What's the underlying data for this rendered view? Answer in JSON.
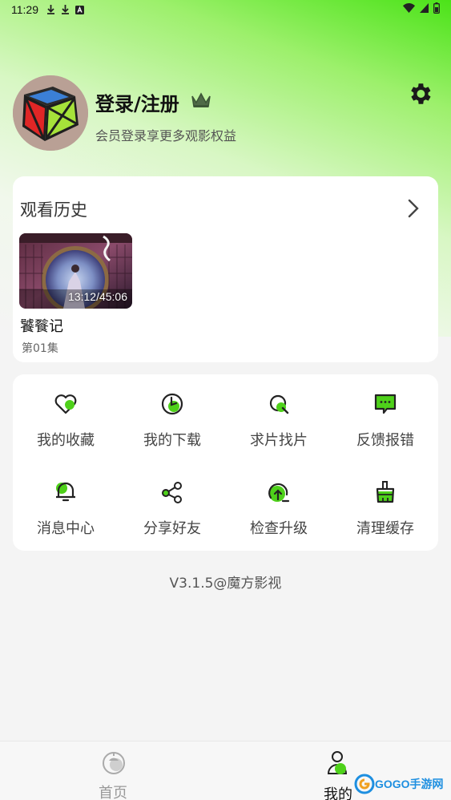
{
  "status_bar": {
    "time": "11:29"
  },
  "profile": {
    "title": "登录/注册",
    "subtitle": "会员登录享更多观影权益"
  },
  "history": {
    "title": "观看历史",
    "items": [
      {
        "time": "13:12/45:06",
        "title": "饕餮记",
        "episode": "第01集"
      }
    ]
  },
  "menu": {
    "items": [
      {
        "label": "我的收藏",
        "icon": "heart-icon"
      },
      {
        "label": "我的下载",
        "icon": "download-icon"
      },
      {
        "label": "求片找片",
        "icon": "search-icon"
      },
      {
        "label": "反馈报错",
        "icon": "feedback-icon"
      },
      {
        "label": "消息中心",
        "icon": "bell-icon"
      },
      {
        "label": "分享好友",
        "icon": "share-icon"
      },
      {
        "label": "检查升级",
        "icon": "upgrade-icon"
      },
      {
        "label": "清理缓存",
        "icon": "broom-icon"
      }
    ]
  },
  "version": "V3.1.5@魔方影视",
  "tabbar": {
    "home": "首页",
    "me": "我的"
  },
  "colors": {
    "accent": "#4ed11a",
    "accent_bright": "#5ee81e"
  }
}
